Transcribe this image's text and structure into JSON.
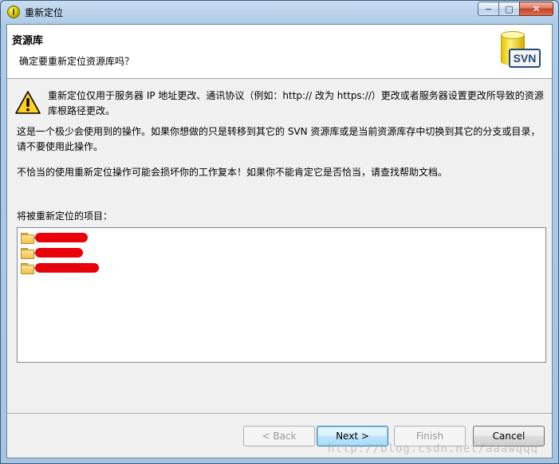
{
  "window": {
    "title": "重新定位",
    "controls": {
      "minimize": "−",
      "maximize": "□",
      "close": "✕"
    }
  },
  "header": {
    "title": "资源库",
    "subtitle": "确定要重新定位资源库吗？",
    "logo_text": "SVN",
    "logo_icon": "svn-database-icon"
  },
  "messages": {
    "warning_icon": "warning-icon",
    "line1": "重新定位仅用于服务器 IP 地址更改、通讯协议（例如：http:// 改为 https://）更改或者服务器设置更改所导致的资源库根路径更改。",
    "line2": "这是一个极少会使用到的操作。如果你想做的只是转移到其它的 SVN 资源库或是当前资源库存中切换到其它的分支或目录，请不要使用此操作。",
    "line3": "不恰当的使用重新定位操作可能会损坏你的工作复本！如果你不能肯定它是否恰当，请查找帮助文档。"
  },
  "projects": {
    "label": "将被重新定位的项目：",
    "items": [
      {
        "icon": "folder-icon",
        "redacted": true
      },
      {
        "icon": "folder-icon",
        "redacted": true
      },
      {
        "icon": "folder-icon",
        "redacted": true
      }
    ]
  },
  "buttons": {
    "back": "< Back",
    "next": "Next >",
    "finish": "Finish",
    "cancel": "Cancel"
  },
  "watermark": "http://blog.csdn.net/aaawqqq",
  "colors": {
    "redaction": "#e8000a",
    "default_button_border": "#3c7fb1"
  }
}
